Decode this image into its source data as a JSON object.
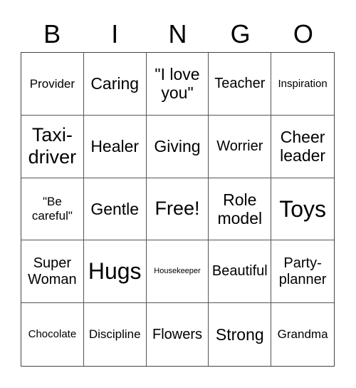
{
  "header": [
    "B",
    "I",
    "N",
    "G",
    "O"
  ],
  "cells": [
    {
      "text": "Provider",
      "size": "fs-m"
    },
    {
      "text": "Caring",
      "size": "fs-xl"
    },
    {
      "text": "\"I love you\"",
      "size": "fs-xl"
    },
    {
      "text": "Teacher",
      "size": "fs-l"
    },
    {
      "text": "Inspiration",
      "size": "fs-s"
    },
    {
      "text": "Taxi-driver",
      "size": "fs-xxl"
    },
    {
      "text": "Healer",
      "size": "fs-xl"
    },
    {
      "text": "Giving",
      "size": "fs-xl"
    },
    {
      "text": "Worrier",
      "size": "fs-l"
    },
    {
      "text": "Cheer leader",
      "size": "fs-xl"
    },
    {
      "text": "\"Be careful\"",
      "size": "fs-m"
    },
    {
      "text": "Gentle",
      "size": "fs-xl"
    },
    {
      "text": "Free!",
      "size": "fs-xxl"
    },
    {
      "text": "Role model",
      "size": "fs-xl"
    },
    {
      "text": "Toys",
      "size": "fs-xxxl"
    },
    {
      "text": "Super Woman",
      "size": "fs-l"
    },
    {
      "text": "Hugs",
      "size": "fs-xxxl"
    },
    {
      "text": "Housekeeper",
      "size": "fs-xs"
    },
    {
      "text": "Beautiful",
      "size": "fs-l"
    },
    {
      "text": "Party-planner",
      "size": "fs-l"
    },
    {
      "text": "Chocolate",
      "size": "fs-s"
    },
    {
      "text": "Discipline",
      "size": "fs-m"
    },
    {
      "text": "Flowers",
      "size": "fs-l"
    },
    {
      "text": "Strong",
      "size": "fs-xl"
    },
    {
      "text": "Grandma",
      "size": "fs-m"
    }
  ]
}
